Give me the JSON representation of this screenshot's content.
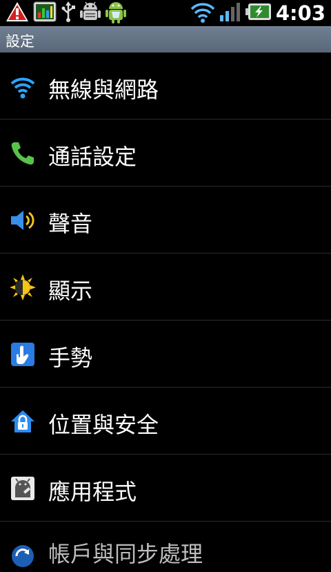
{
  "status_bar": {
    "left_icons": [
      "warning-icon",
      "chart-app-icon",
      "usb-icon",
      "android-debug-icon",
      "android-market-icon"
    ],
    "right_icons": [
      "wifi-icon",
      "signal-icon",
      "battery-charging-icon"
    ],
    "time": "4:03"
  },
  "title_bar": {
    "title": "設定"
  },
  "settings": {
    "items": [
      {
        "label": "無線與網路",
        "icon": "wifi-icon"
      },
      {
        "label": "通話設定",
        "icon": "phone-icon"
      },
      {
        "label": "聲音",
        "icon": "speaker-icon"
      },
      {
        "label": "顯示",
        "icon": "brightness-icon"
      },
      {
        "label": "手勢",
        "icon": "gesture-icon"
      },
      {
        "label": "位置與安全",
        "icon": "lock-home-icon"
      },
      {
        "label": "應用程式",
        "icon": "applications-icon"
      },
      {
        "label": "帳戶與同步處理",
        "icon": "sync-icon"
      }
    ]
  },
  "colors": {
    "background": "#000000",
    "title_bar": "#637184",
    "divider": "#2b2b2b",
    "accent_blue": "#2a8bff",
    "text": "#ffffff"
  }
}
